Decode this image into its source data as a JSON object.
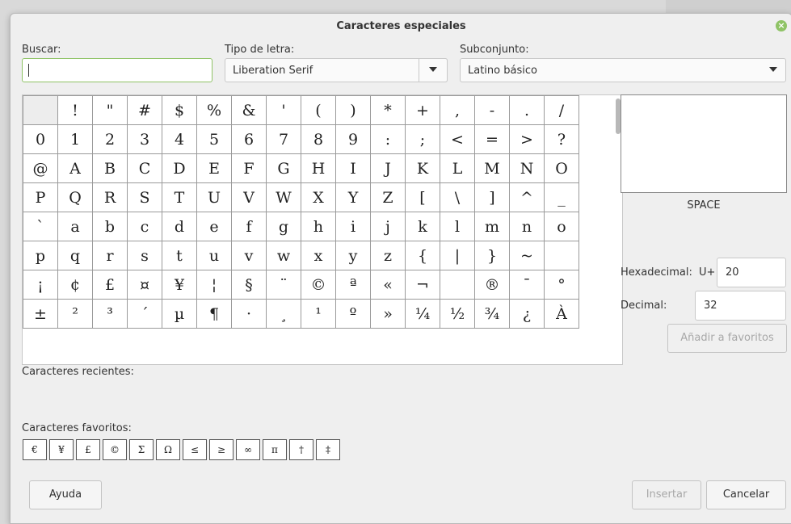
{
  "window": {
    "title": "Caracteres especiales"
  },
  "search": {
    "label": "Buscar:",
    "value": ""
  },
  "font": {
    "label": "Tipo de letra:",
    "value": "Liberation Serif"
  },
  "subset": {
    "label": "Subconjunto:",
    "value": "Latino básico"
  },
  "grid": {
    "rows": [
      [
        "",
        "!",
        "\"",
        "#",
        "$",
        "%",
        "&",
        "'",
        "(",
        ")",
        "*",
        "+",
        ",",
        "-",
        ".",
        "/"
      ],
      [
        "0",
        "1",
        "2",
        "3",
        "4",
        "5",
        "6",
        "7",
        "8",
        "9",
        ":",
        ";",
        "<",
        "=",
        ">",
        "?"
      ],
      [
        "@",
        "A",
        "B",
        "C",
        "D",
        "E",
        "F",
        "G",
        "H",
        "I",
        "J",
        "K",
        "L",
        "M",
        "N",
        "O"
      ],
      [
        "P",
        "Q",
        "R",
        "S",
        "T",
        "U",
        "V",
        "W",
        "X",
        "Y",
        "Z",
        "[",
        "\\",
        "]",
        "^",
        "_"
      ],
      [
        "`",
        "a",
        "b",
        "c",
        "d",
        "e",
        "f",
        "g",
        "h",
        "i",
        "j",
        "k",
        "l",
        "m",
        "n",
        "o"
      ],
      [
        "p",
        "q",
        "r",
        "s",
        "t",
        "u",
        "v",
        "w",
        "x",
        "y",
        "z",
        "{",
        "|",
        "}",
        "~",
        ""
      ],
      [
        "¡",
        "¢",
        "£",
        "¤",
        "¥",
        "¦",
        "§",
        "¨",
        "©",
        "ª",
        "«",
        "¬",
        "",
        "®",
        "¯",
        "°"
      ],
      [
        "±",
        "²",
        "³",
        "´",
        "µ",
        "¶",
        "·",
        "¸",
        "¹",
        "º",
        "»",
        "¼",
        "½",
        "¾",
        "¿",
        "À"
      ]
    ]
  },
  "preview": {
    "char_name": "SPACE"
  },
  "code": {
    "hex_label": "Hexadecimal:",
    "hex_prefix": "U+",
    "hex_value": "20",
    "dec_label": "Decimal:",
    "dec_value": "32"
  },
  "buttons": {
    "add_favorite": "Añadir a favoritos",
    "help": "Ayuda",
    "insert": "Insertar",
    "cancel": "Cancelar"
  },
  "recent": {
    "label": "Caracteres recientes:"
  },
  "favorites": {
    "label": "Caracteres favoritos:",
    "items": [
      "€",
      "¥",
      "£",
      "©",
      "Σ",
      "Ω",
      "≤",
      "≥",
      "∞",
      "π",
      "†",
      "‡"
    ]
  },
  "icons": {
    "close": "close-icon",
    "dropdown": "chevron-down-icon"
  },
  "colors": {
    "accent": "#8fc366"
  }
}
